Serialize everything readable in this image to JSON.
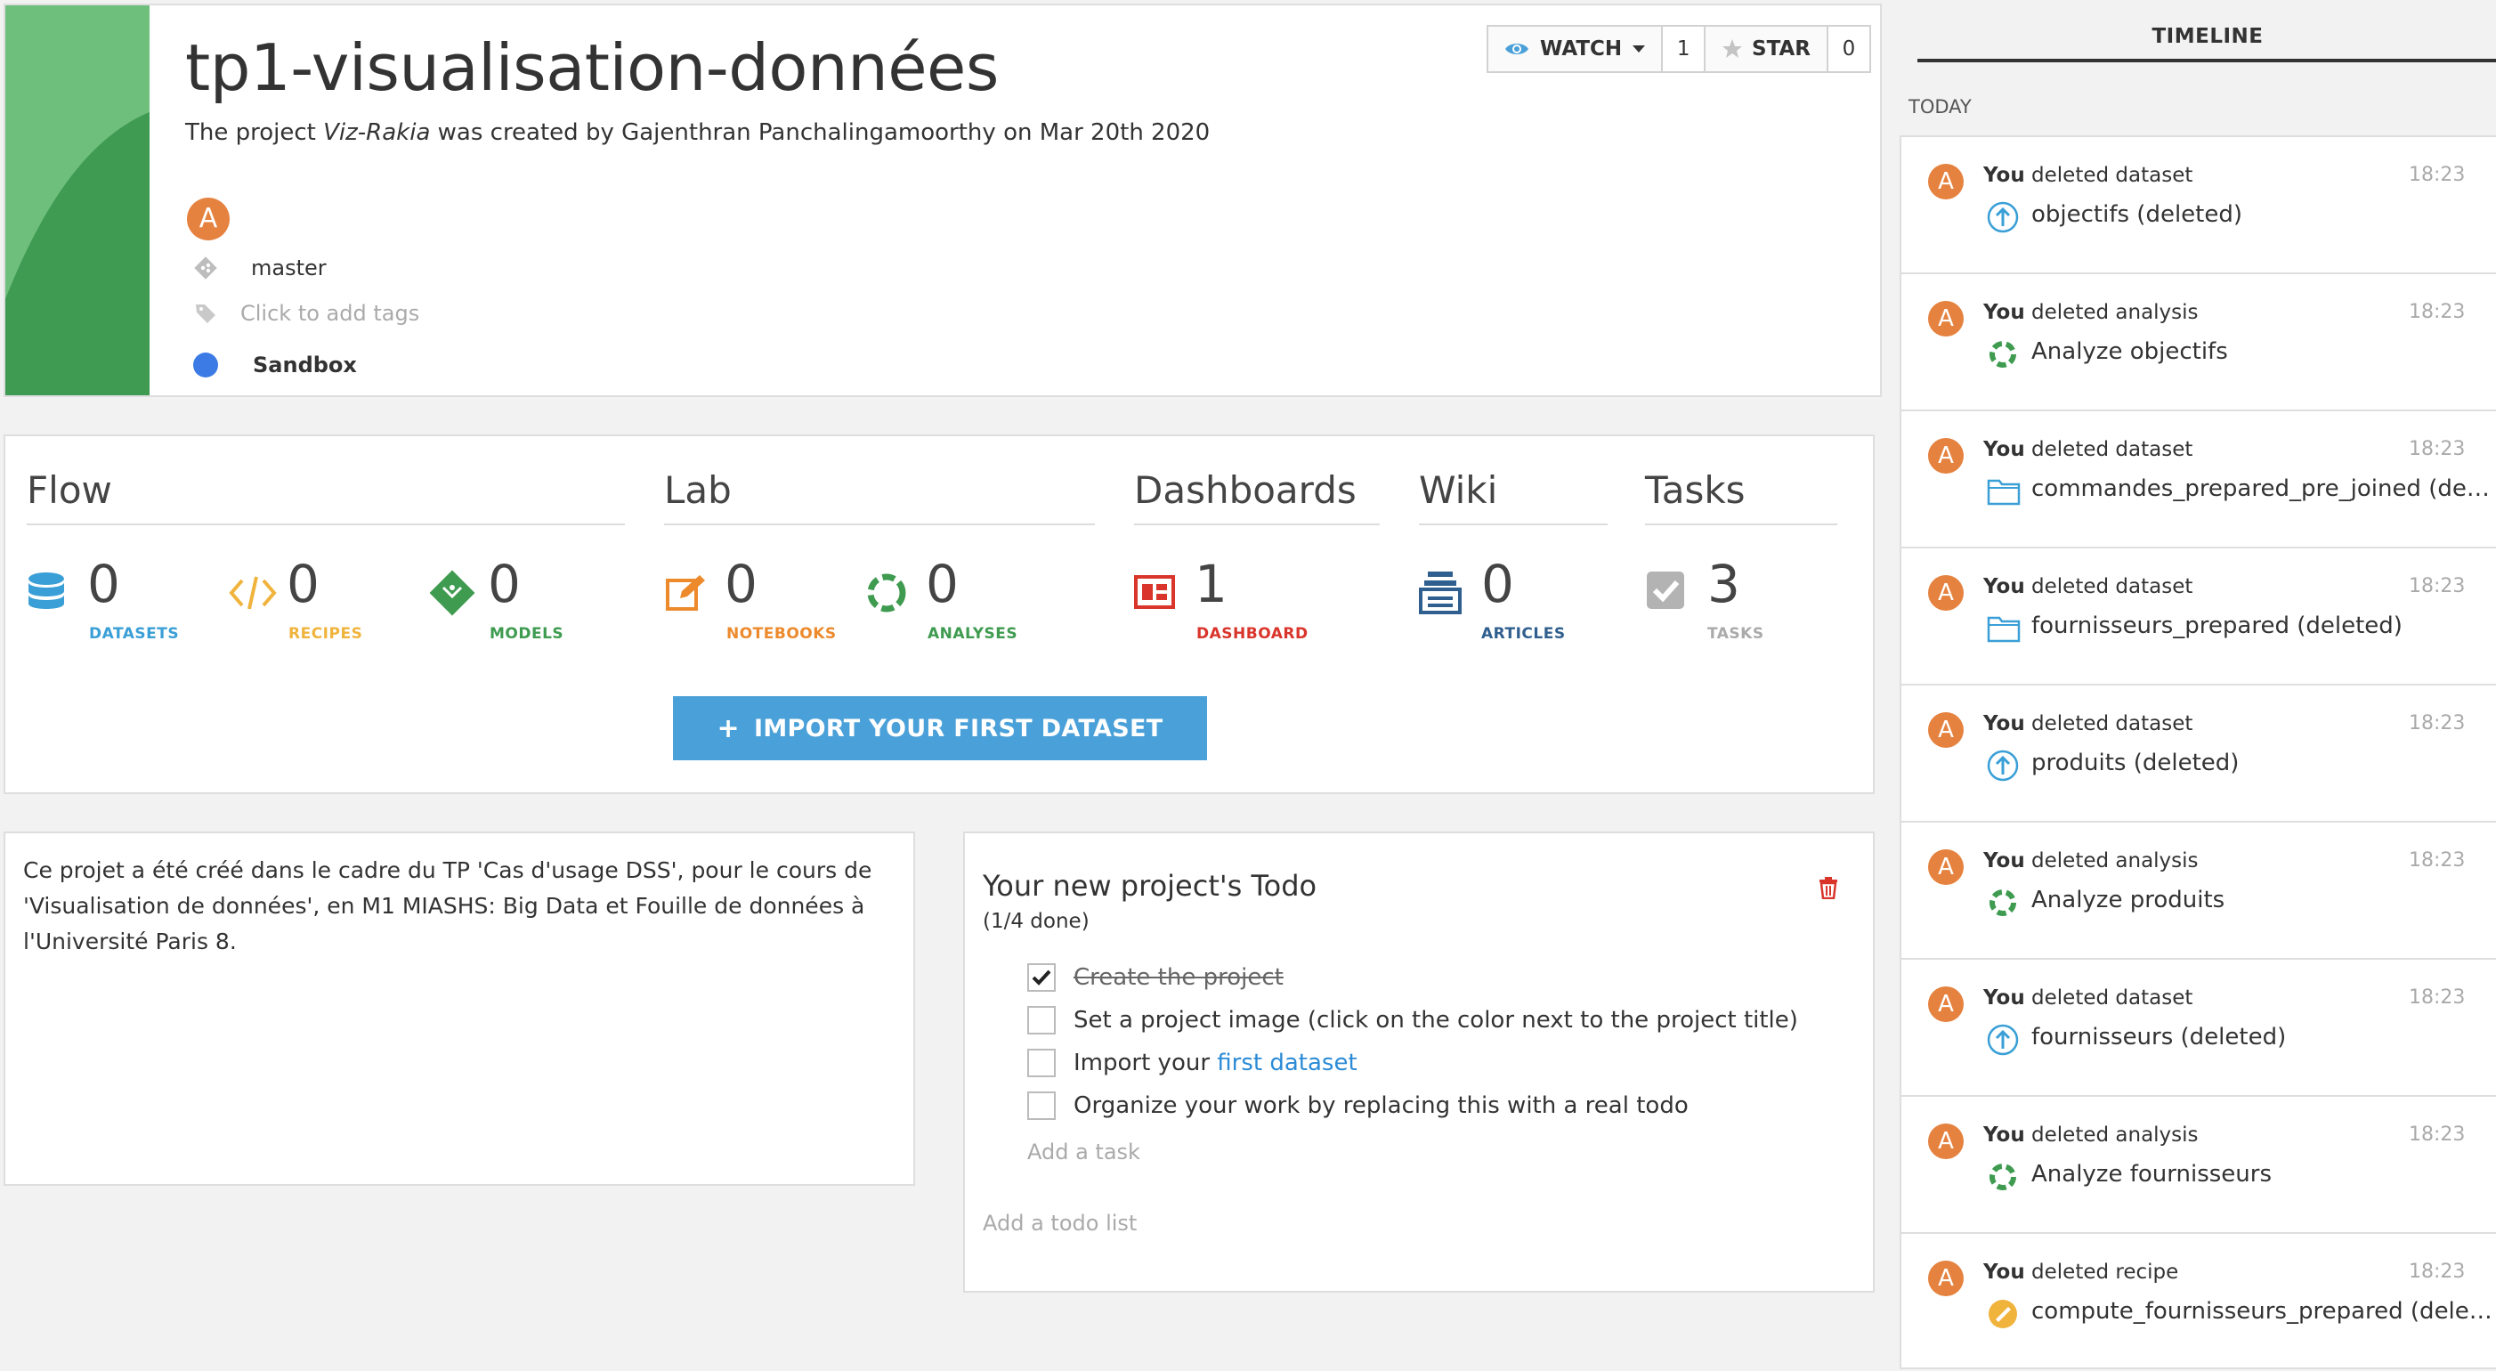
{
  "project": {
    "title": "tp1-visualisation-données",
    "subtitle_prefix": "The project ",
    "subtitle_key": "Viz-Rakia",
    "subtitle_suffix": " was created by Gajenthran Panchalingamoorthy on Mar 20th 2020",
    "owner_initial": "A",
    "branch": "master",
    "tags_placeholder": "Click to add tags",
    "status": "Sandbox",
    "image_color": "#4aa35c",
    "status_color": "#3c7be6"
  },
  "actions": {
    "watch_label": "WATCH",
    "watch_count": "1",
    "star_label": "STAR",
    "star_count": "0"
  },
  "sections": {
    "flow": "Flow",
    "lab": "Lab",
    "dashboards": "Dashboards",
    "wiki": "Wiki",
    "tasks": "Tasks"
  },
  "stats": {
    "datasets": {
      "value": "0",
      "label": "DATASETS",
      "color": "#3a9fd6",
      "icon": "database-icon"
    },
    "recipes": {
      "value": "0",
      "label": "RECIPES",
      "color": "#f0b33c",
      "icon": "code-icon"
    },
    "models": {
      "value": "0",
      "label": "MODELS",
      "color": "#3e9b4f",
      "icon": "model-icon"
    },
    "notebooks": {
      "value": "0",
      "label": "NOTEBOOKS",
      "color": "#ec8a2c",
      "icon": "notebook-icon"
    },
    "analyses": {
      "value": "0",
      "label": "ANALYSES",
      "color": "#3e9b4f",
      "icon": "analysis-icon"
    },
    "dashboard": {
      "value": "1",
      "label": "DASHBOARD",
      "color": "#d9352b",
      "icon": "dashboard-icon"
    },
    "articles": {
      "value": "0",
      "label": "ARTICLES",
      "color": "#2f5f8f",
      "icon": "article-icon"
    },
    "tasks": {
      "value": "3",
      "label": "TASKS",
      "color": "#aaaaaa",
      "icon": "checkbox-icon"
    }
  },
  "import_button": {
    "plus": "+",
    "label": "IMPORT YOUR FIRST DATASET"
  },
  "description": "Ce projet a été créé dans le cadre du TP 'Cas d'usage DSS', pour le cours de 'Visualisation de données', en M1 MIASHS: Big Data et Fouille de données à l'Université Paris 8.",
  "todo": {
    "title": "Your new project's Todo",
    "progress": "(1/4 done)",
    "items": [
      {
        "text": "Create the project",
        "done": true
      },
      {
        "text": "Set a project image (click on the color next to the project title)",
        "done": false
      },
      {
        "text_before": "Import your ",
        "link": "first dataset",
        "done": false
      },
      {
        "text": "Organize your work by replacing this with a real todo",
        "done": false
      }
    ],
    "add_task": "Add a task",
    "add_list": "Add a todo list"
  },
  "timeline": {
    "title": "TIMELINE",
    "today": "TODAY",
    "items": [
      {
        "actor": "You",
        "action": " deleted dataset",
        "time": "18:23",
        "object": "objectifs (deleted)",
        "icon": "upload-icon"
      },
      {
        "actor": "You",
        "action": " deleted analysis",
        "time": "18:23",
        "object": "Analyze objectifs",
        "icon": "analysis-icon"
      },
      {
        "actor": "You",
        "action": " deleted dataset",
        "time": "18:23",
        "object": "commandes_prepared_pre_joined (deleted)",
        "icon": "folder-icon"
      },
      {
        "actor": "You",
        "action": " deleted dataset",
        "time": "18:23",
        "object": "fournisseurs_prepared (deleted)",
        "icon": "folder-icon"
      },
      {
        "actor": "You",
        "action": " deleted dataset",
        "time": "18:23",
        "object": "produits (deleted)",
        "icon": "upload-icon"
      },
      {
        "actor": "You",
        "action": " deleted analysis",
        "time": "18:23",
        "object": "Analyze produits",
        "icon": "analysis-icon"
      },
      {
        "actor": "You",
        "action": " deleted dataset",
        "time": "18:23",
        "object": "fournisseurs (deleted)",
        "icon": "upload-icon"
      },
      {
        "actor": "You",
        "action": " deleted analysis",
        "time": "18:23",
        "object": "Analyze fournisseurs",
        "icon": "analysis-icon"
      },
      {
        "actor": "You",
        "action": " deleted recipe",
        "time": "18:23",
        "object": "compute_fournisseurs_prepared (deleted)",
        "icon": "recipe-icon"
      }
    ]
  }
}
